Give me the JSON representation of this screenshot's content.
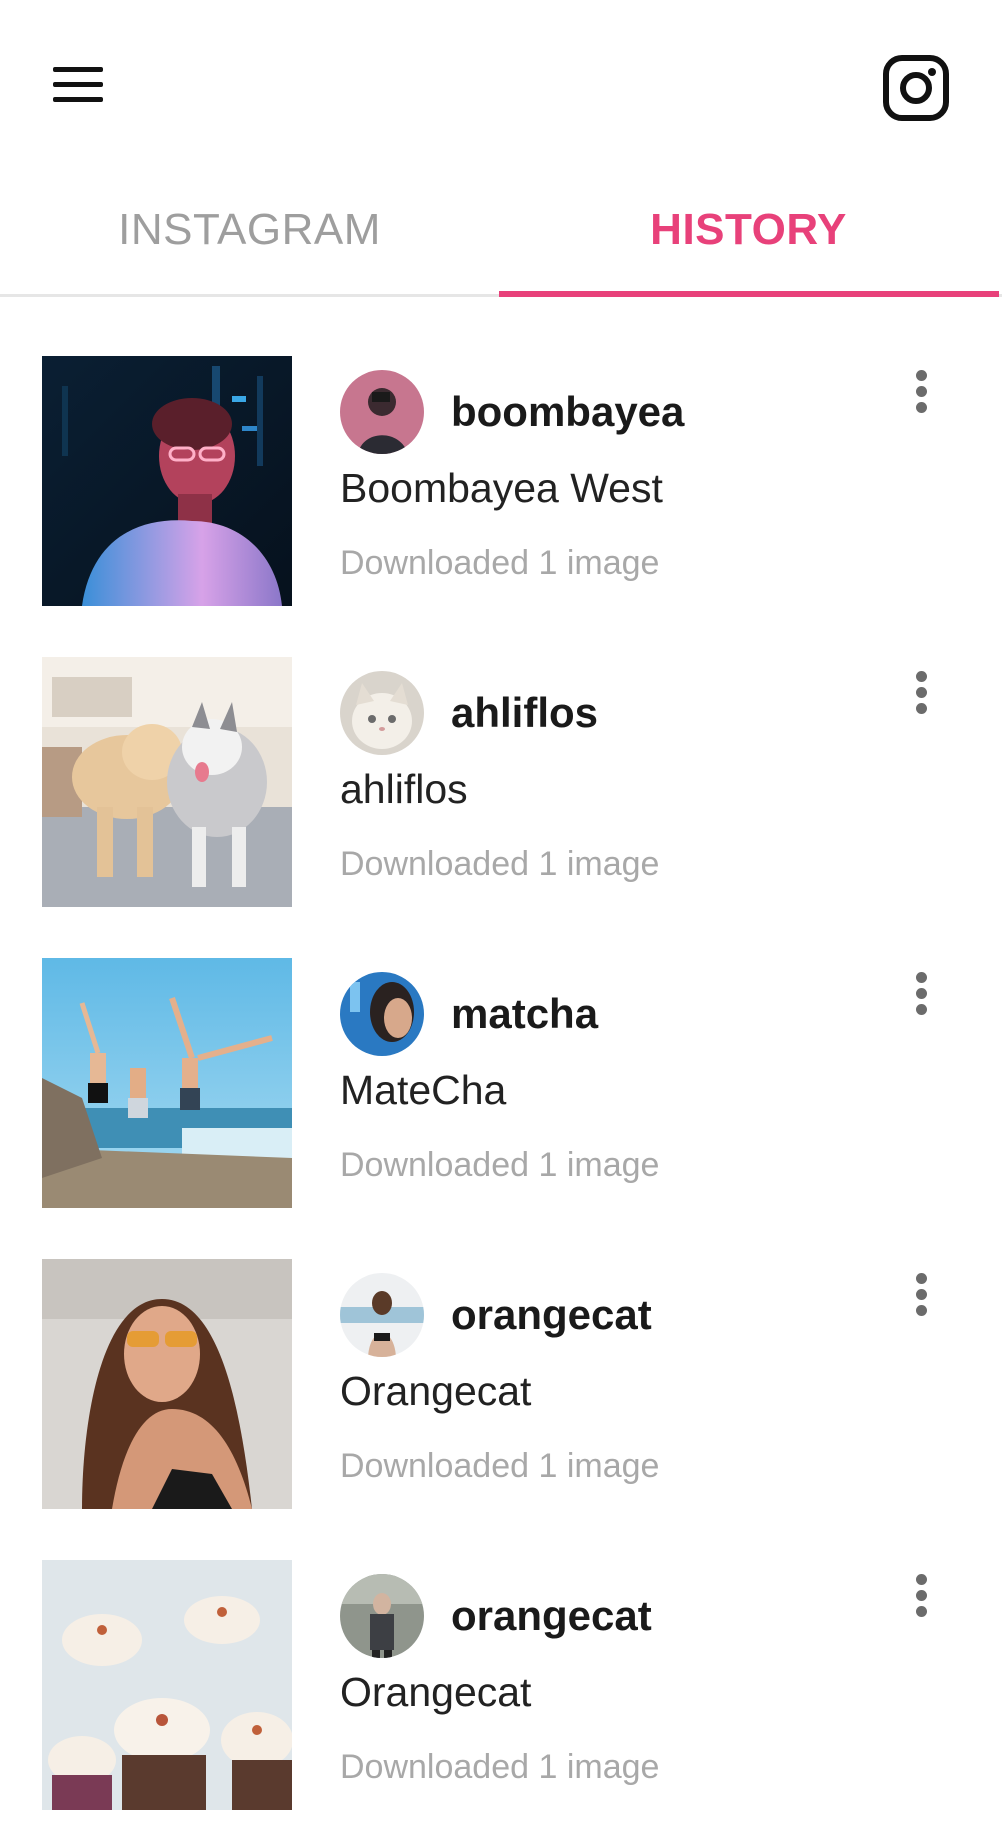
{
  "app": {
    "menu_icon": "hamburger-menu-icon",
    "logo_icon": "instagram-logo-icon",
    "accent_color": "#e8417a"
  },
  "tabs": [
    {
      "label": "INSTAGRAM",
      "selected": false
    },
    {
      "label": "HISTORY",
      "selected": true
    }
  ],
  "history": [
    {
      "username": "boombayea",
      "full_name": "Boombayea West",
      "status": "Downloaded 1 image",
      "menu_icon": "more-vertical-icon"
    },
    {
      "username": "ahliflos",
      "full_name": "ahliflos",
      "status": "Downloaded 1 image",
      "menu_icon": "more-vertical-icon"
    },
    {
      "username": "matcha",
      "full_name": "MateCha",
      "status": "Downloaded 1 image",
      "menu_icon": "more-vertical-icon"
    },
    {
      "username": "orangecat",
      "full_name": "Orangecat",
      "status": "Downloaded 1 image",
      "menu_icon": "more-vertical-icon"
    },
    {
      "username": "orangecat",
      "full_name": "Orangecat",
      "status": "Downloaded 1 image",
      "menu_icon": "more-vertical-icon"
    }
  ]
}
